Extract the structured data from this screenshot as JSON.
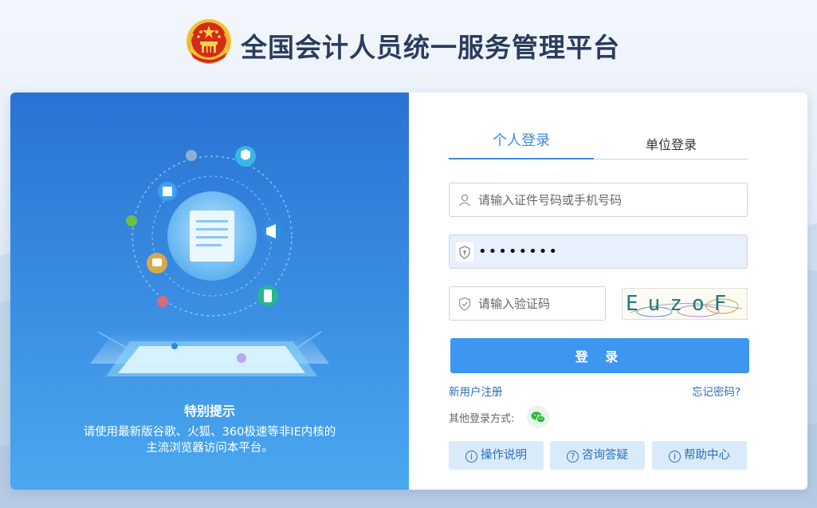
{
  "header": {
    "title": "全国会计人员统一服务管理平台"
  },
  "notice": {
    "title": "特别提示",
    "lines": [
      "请使用最新版谷歌、火狐、360极速等非IE内核的",
      "主流浏览器访问本平台。"
    ]
  },
  "tabs": [
    {
      "label": "个人登录",
      "active": true
    },
    {
      "label": "单位登录",
      "active": false
    }
  ],
  "form": {
    "user_placeholder": "请输入证件号码或手机号码",
    "password_value": "••••••••",
    "captcha_placeholder": "请输入验证码",
    "captcha_text": "EuzoF",
    "login_label": "登 录"
  },
  "links": {
    "register": "新用户注册",
    "forgot": "忘记密码?"
  },
  "other_login": {
    "label": "其他登录方式:",
    "icon": "wechat-icon"
  },
  "help_buttons": [
    {
      "label": "操作说明",
      "icon": "info-icon"
    },
    {
      "label": "咨询答疑",
      "icon": "question-icon"
    },
    {
      "label": "帮助中心",
      "icon": "info-icon"
    }
  ],
  "colors": {
    "primary": "#3d96f0",
    "tab_active": "#3f8be0",
    "link": "#2b6fb8",
    "panel_top": "#2a72d4",
    "panel_bottom": "#4aa8ef"
  }
}
